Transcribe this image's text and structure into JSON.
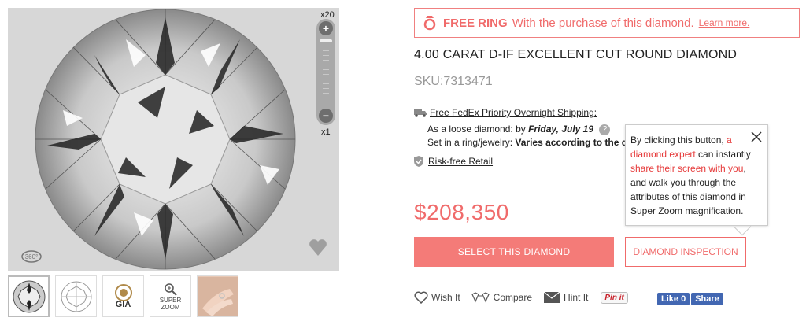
{
  "viewer": {
    "zoom_max_label": "x20",
    "zoom_min_label": "x1",
    "plus_label": "+",
    "minus_label": "−",
    "rotate_label": "360°"
  },
  "thumbnails": [
    {
      "name": "diamond-photo"
    },
    {
      "name": "diamond-diagram"
    },
    {
      "name": "gia-certificate",
      "label": "GIA"
    },
    {
      "name": "super-zoom",
      "label": "SUPER ZOOM"
    },
    {
      "name": "hand-photo"
    }
  ],
  "promo": {
    "title": "FREE RING",
    "text": "With the purchase of this diamond.",
    "link": "Learn more."
  },
  "product": {
    "title": "4.00 CARAT D-IF EXCELLENT CUT ROUND DIAMOND",
    "sku": "SKU:7313471"
  },
  "shipping": {
    "heading": "Free FedEx Priority Overnight Shipping:",
    "loose_prefix": "As a loose diamond: by ",
    "loose_date": "Friday, July 19",
    "help": "?",
    "ring_prefix": "Set in a ring/jewelry: ",
    "ring_value": "Varies according to the diff",
    "risk": "Risk-free Retail"
  },
  "price": "$208,350",
  "buttons": {
    "select": "SELECT THIS DIAMOND",
    "inspect": "DIAMOND INSPECTION"
  },
  "tooltip": {
    "p1": "By clicking this button, ",
    "p2": "a diamond expert",
    "p3": " can instantly ",
    "p4": "share their screen with you",
    "p5": ", and walk you through the attributes of this diamond in Super Zoom magnification."
  },
  "actions": {
    "wish": "Wish It",
    "compare": "Compare",
    "hint": "Hint It",
    "pin": "Pin it",
    "like": "Like 0",
    "share": "Share"
  },
  "colors": {
    "accent": "#f06b6b",
    "button": "#f47b78",
    "facebook": "#4267b2"
  }
}
